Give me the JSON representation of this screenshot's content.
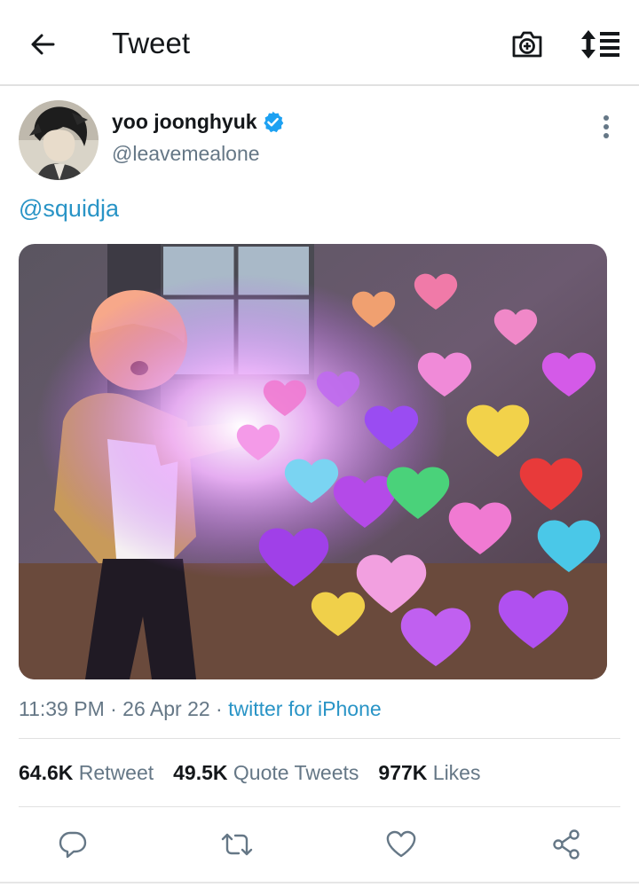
{
  "header": {
    "title": "Tweet",
    "back_icon": "arrow-left-icon",
    "camera_icon": "camera-add-icon",
    "sort_icon": "sort-list-icon"
  },
  "tweet": {
    "display_name": "yoo joonghyuk",
    "handle": "@leavemealone",
    "verified": true,
    "text": "@squidja",
    "timestamp": "11:39 PM · 26 Apr 22 · ",
    "source": "twitter for iPhone",
    "media_alt": "photo of a person shooting a beam of colorful hearts"
  },
  "stats": [
    {
      "count": "64.6K",
      "label": "Retweet"
    },
    {
      "count": "49.5K",
      "label": "Quote Tweets"
    },
    {
      "count": "977K",
      "label": "Likes"
    }
  ],
  "actions": [
    "reply-icon",
    "retweet-icon",
    "like-icon",
    "share-icon"
  ],
  "colors": {
    "accent": "#2994c6",
    "verified": "#1da1f2",
    "secondary_text": "#657786",
    "primary_text": "#14171a",
    "divider": "#e1e1e1"
  }
}
